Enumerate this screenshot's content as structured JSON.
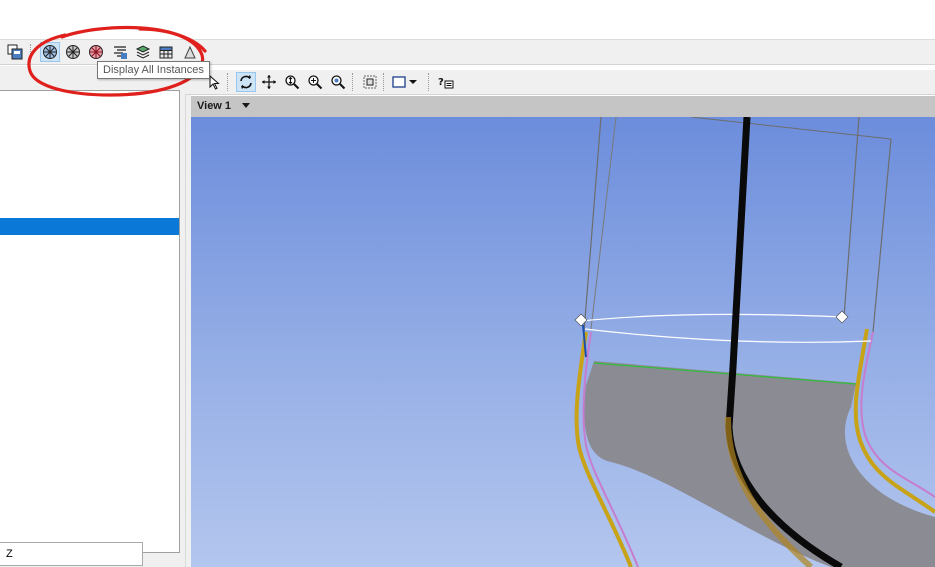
{
  "tooltip": {
    "text": "Display All Instances"
  },
  "view": {
    "title": "View 1"
  },
  "fields": {
    "z_label": "Z"
  },
  "toolbar_top": {
    "icons": [
      "new-window-icon",
      "display-single-instance-icon",
      "display-all-instances-icon",
      "display-instances-icon",
      "display-options-icon",
      "layers-icon",
      "grid-icon",
      "shape-icon"
    ]
  },
  "toolbar_view": {
    "icons": [
      "select-cursor-icon",
      "rotate-icon",
      "pan-icon",
      "zoom-icon",
      "zoom-in-icon",
      "zoom-fit-icon",
      "zoom-box-icon",
      "display-mode-icon",
      "dropdown-arrow-icon",
      "help-icon"
    ]
  },
  "annotation": {
    "color": "#e0201c"
  },
  "colors": {
    "selection": "#0a78d7",
    "viewport_top": "#6c8ddc",
    "viewport_bottom": "#b3c6ee"
  }
}
